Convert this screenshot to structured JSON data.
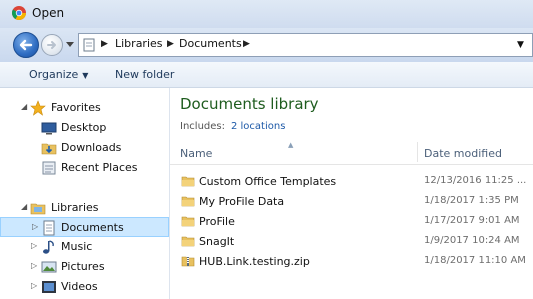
{
  "window": {
    "title": "Open",
    "app_icon": "chrome-icon"
  },
  "nav": {
    "back_icon": "back-arrow-icon",
    "forward_icon": "forward-arrow-icon",
    "breadcrumbs": [
      "Libraries",
      "Documents"
    ]
  },
  "toolbar": {
    "organize_label": "Organize",
    "new_folder_label": "New folder"
  },
  "sidebar": {
    "favorites": {
      "label": "Favorites",
      "items": [
        {
          "label": "Desktop",
          "icon": "desktop-icon"
        },
        {
          "label": "Downloads",
          "icon": "downloads-icon"
        },
        {
          "label": "Recent Places",
          "icon": "recent-places-icon"
        }
      ]
    },
    "libraries": {
      "label": "Libraries",
      "items": [
        {
          "label": "Documents",
          "icon": "documents-icon",
          "selected": true
        },
        {
          "label": "Music",
          "icon": "music-icon"
        },
        {
          "label": "Pictures",
          "icon": "pictures-icon"
        },
        {
          "label": "Videos",
          "icon": "videos-icon"
        }
      ]
    }
  },
  "main": {
    "title": "Documents library",
    "includes_label": "Includes:",
    "includes_link": "2 locations",
    "columns": {
      "name": "Name",
      "date": "Date modified"
    },
    "files": [
      {
        "name": "Custom Office Templates",
        "date": "12/13/2016 11:25 ...",
        "type": "folder"
      },
      {
        "name": "My ProFile Data",
        "date": "1/18/2017 1:35 PM",
        "type": "folder"
      },
      {
        "name": "ProFile",
        "date": "1/17/2017 9:01 AM",
        "type": "folder"
      },
      {
        "name": "SnagIt",
        "date": "1/9/2017 10:24 AM",
        "type": "folder"
      },
      {
        "name": "HUB.Link.testing.zip",
        "date": "1/18/2017 11:10 AM",
        "type": "zip"
      }
    ]
  },
  "colors": {
    "accent_green": "#1e5c1e",
    "link_blue": "#1e5aa8",
    "selection": "#cce8ff"
  }
}
